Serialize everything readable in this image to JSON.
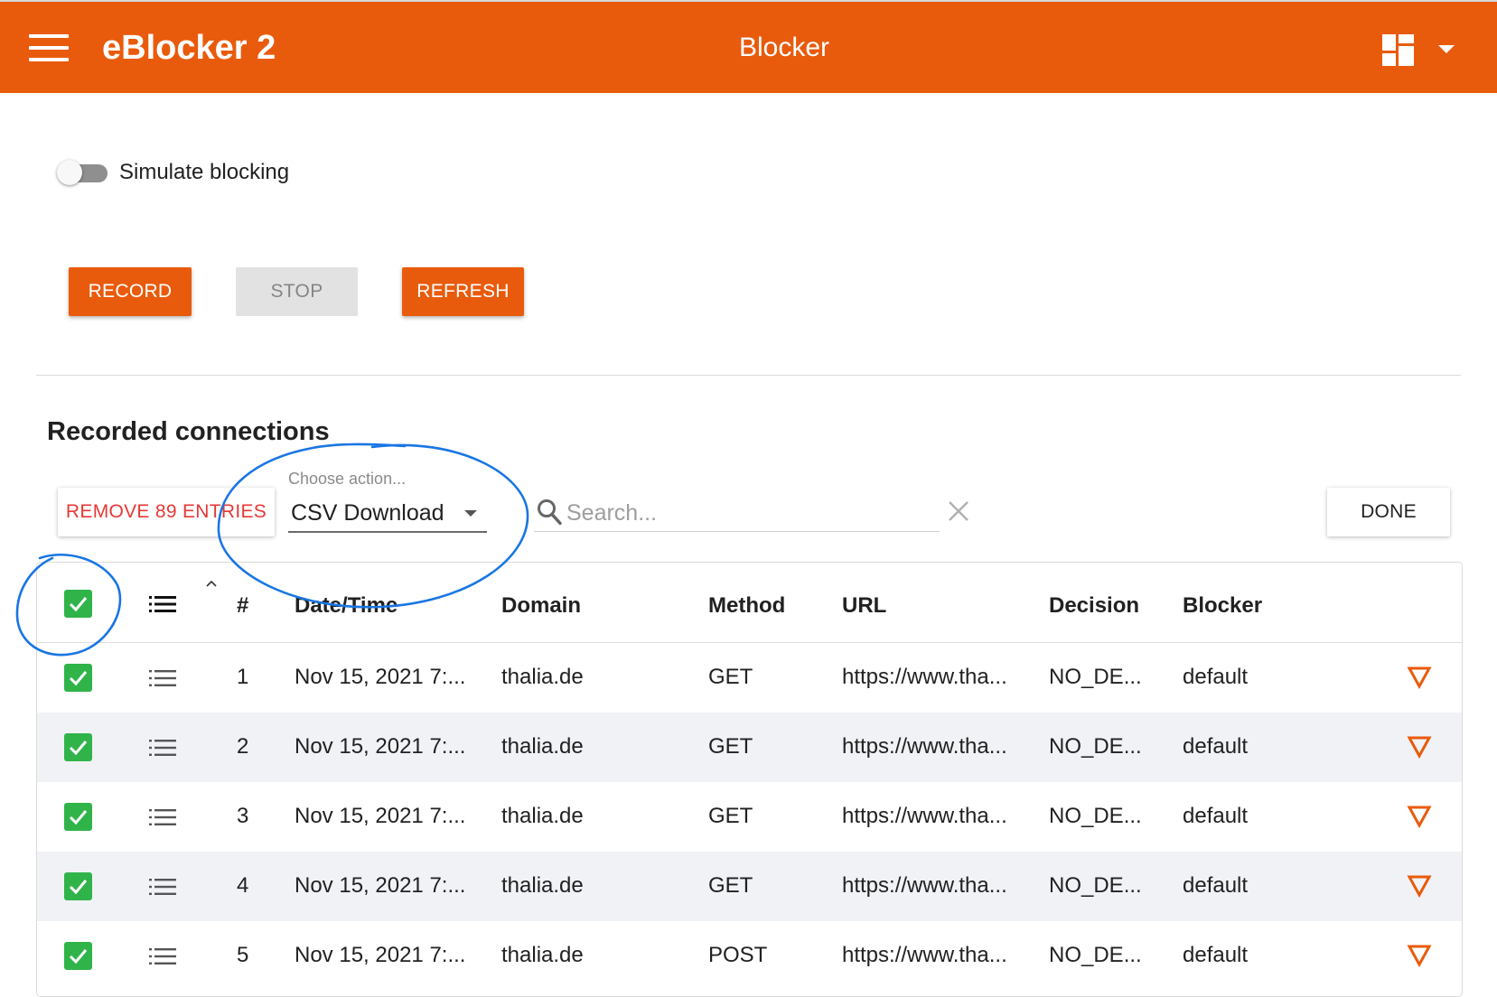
{
  "app": {
    "title": "eBlocker 2",
    "page_title": "Blocker",
    "menu_icon": "hamburger-menu-icon",
    "dashboard_icon": "dashboard-icon",
    "dropdown_icon": "caret-down-icon"
  },
  "colors": {
    "primary": "#e95b0c",
    "checkbox": "#30b44a",
    "remove_text": "#e53935",
    "annotation": "#1976e3",
    "row_alt": "#f0f2f6"
  },
  "simulate": {
    "label": "Simulate blocking",
    "checked": false
  },
  "buttons": {
    "record": "RECORD",
    "stop": "STOP",
    "refresh": "REFRESH"
  },
  "recorded": {
    "title": "Recorded connections",
    "remove_label": "REMOVE 89 ENTRIES",
    "action_label": "Choose action...",
    "action_value": "CSV Download",
    "search_placeholder": "Search...",
    "done_label": "DONE"
  },
  "table": {
    "headers": {
      "num": "#",
      "datetime": "Date/Time",
      "domain": "Domain",
      "method": "Method",
      "url": "URL",
      "decision": "Decision",
      "blocker": "Blocker"
    },
    "rows": [
      {
        "num": "1",
        "datetime": "Nov 15, 2021 7:...",
        "domain": "thalia.de",
        "method": "GET",
        "url": "https://www.tha...",
        "decision": "NO_DE...",
        "blocker": "default",
        "checked": true
      },
      {
        "num": "2",
        "datetime": "Nov 15, 2021 7:...",
        "domain": "thalia.de",
        "method": "GET",
        "url": "https://www.tha...",
        "decision": "NO_DE...",
        "blocker": "default",
        "checked": true
      },
      {
        "num": "3",
        "datetime": "Nov 15, 2021 7:...",
        "domain": "thalia.de",
        "method": "GET",
        "url": "https://www.tha...",
        "decision": "NO_DE...",
        "blocker": "default",
        "checked": true
      },
      {
        "num": "4",
        "datetime": "Nov 15, 2021 7:...",
        "domain": "thalia.de",
        "method": "GET",
        "url": "https://www.tha...",
        "decision": "NO_DE...",
        "blocker": "default",
        "checked": true
      },
      {
        "num": "5",
        "datetime": "Nov 15, 2021 7:...",
        "domain": "thalia.de",
        "method": "POST",
        "url": "https://www.tha...",
        "decision": "NO_DE...",
        "blocker": "default",
        "checked": true
      }
    ]
  }
}
